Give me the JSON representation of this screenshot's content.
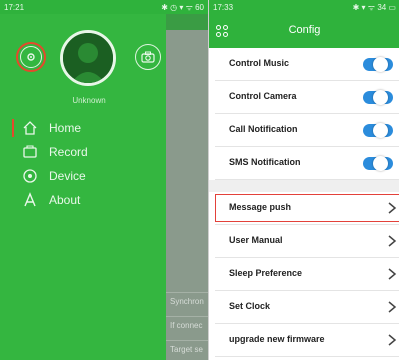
{
  "left_phone": {
    "status_bar": {
      "time": "17:21",
      "right": "✱ ◷ ▾ ᯤ 60"
    },
    "drawer": {
      "username": "Unknown",
      "menu": [
        {
          "label": "Home",
          "icon": "home-icon",
          "active": true
        },
        {
          "label": "Record",
          "icon": "record-icon",
          "active": false
        },
        {
          "label": "Device",
          "icon": "device-icon",
          "active": false
        },
        {
          "label": "About",
          "icon": "about-icon",
          "active": false
        }
      ]
    },
    "background_screen": {
      "texts": [
        "Synchron",
        "If connec",
        "Target se"
      ]
    }
  },
  "right_phone": {
    "status_bar": {
      "time": "17:33",
      "right": "✱ ▾ ᯤ 34 ▭"
    },
    "header": {
      "title": "Config",
      "back_icon": "back-grid-icon"
    },
    "toggle_rows": [
      {
        "label": "Control Music",
        "on": true
      },
      {
        "label": "Control Camera",
        "on": true
      },
      {
        "label": "Call Notification",
        "on": true
      },
      {
        "label": "SMS Notification",
        "on": true
      }
    ],
    "nav_rows": [
      {
        "label": "Message push",
        "highlighted": true
      },
      {
        "label": "User Manual",
        "highlighted": false
      },
      {
        "label": "Sleep Preference",
        "highlighted": false
      },
      {
        "label": "Set Clock",
        "highlighted": false
      },
      {
        "label": "upgrade new firmware",
        "highlighted": false
      }
    ]
  },
  "colors": {
    "brand_green": "#2fb23c",
    "toggle_blue": "#2b8cdc",
    "highlight_red": "#e3413a"
  }
}
